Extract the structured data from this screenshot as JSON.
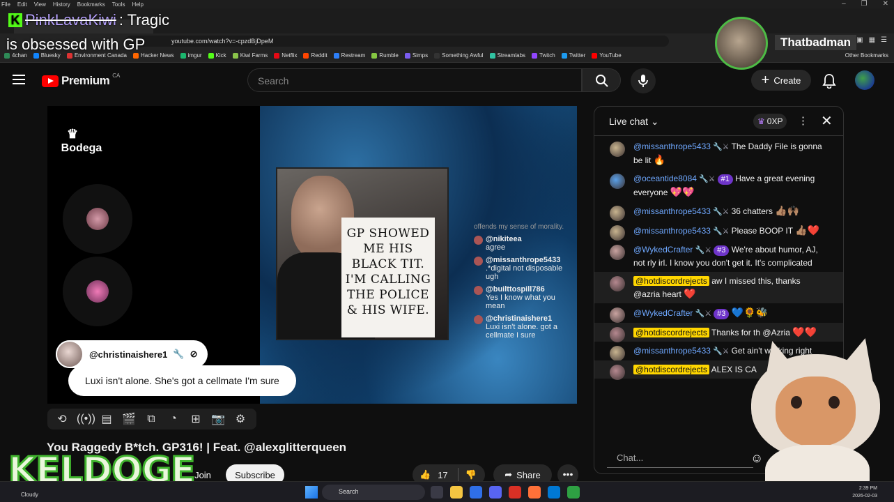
{
  "browser": {
    "menu": [
      "File",
      "Edit",
      "View",
      "History",
      "Bookmarks",
      "Tools",
      "Help"
    ],
    "url": "youtube.com/watch?v=-cpzdBjDpeM",
    "bookmarks": [
      "4chan",
      "Bluesky",
      "Environment Canada",
      "Hacker News",
      "imgur",
      "Kick",
      "Kiwi Farms",
      "Netflix",
      "Reddit",
      "Restream",
      "Rumble",
      "Simps",
      "Something Awful",
      "Streamlabs",
      "Twitch",
      "Twitter",
      "YouTube"
    ],
    "bookmark_colors": [
      "#2e8b57",
      "#1185fe",
      "#d33",
      "#ff6600",
      "#1bb76e",
      "#53fc18",
      "#8ac34a",
      "#e50914",
      "#ff4500",
      "#2d7ff9",
      "#85c742",
      "#7a5cf0",
      "#333333",
      "#31c3a2",
      "#9146ff",
      "#1d9bf0",
      "#ff0000"
    ],
    "other_bookmarks": "Other Bookmarks"
  },
  "overlay": {
    "line1_name": "PinkLavaKiwi",
    "line1_rest": ": Tragic",
    "line2": "is obsessed with GP",
    "streamer_name": "Thatbadman",
    "bottom_logo": "KELDOGE"
  },
  "youtube": {
    "brand": "Premium",
    "region": "CA",
    "search_placeholder": "Search",
    "create_label": "Create"
  },
  "video": {
    "channel_logo": "Bodega",
    "sign_text": "GP SHOWED ME HIS BLACK TIT. I'M CALLING THE POLICE & HIS WIFE.",
    "highlight_user": "@christinaishere1",
    "highlight_message": "Luxi isn't alone. She's got a cellmate I'm sure",
    "embedded_chat": [
      {
        "user": "",
        "text": "offends my sense of morality.",
        "faded": true
      },
      {
        "user": "@nikiteea",
        "text": "agree"
      },
      {
        "user": "@missanthrope5433",
        "text": ".*digital not disposable ugh"
      },
      {
        "user": "@builttospill786",
        "text": "Yes I know what you mean"
      },
      {
        "user": "@christinaishere1",
        "text": "Luxi isn't alone. got a cellmate I sure"
      }
    ],
    "title": "You Raggedy B*tch. GP316! | Feat. @alexglitterqueen",
    "join_label": "Join",
    "subscribe_label": "Subscribe",
    "likes": "17",
    "share_label": "Share"
  },
  "chat": {
    "title": "Live chat",
    "xp": "0XP",
    "input_placeholder": "Chat...",
    "messages": [
      {
        "user": "@missanthrope5433",
        "badge": "",
        "text": "The Daddy File is gonna be lit",
        "emoji": "🔥",
        "owner": false,
        "color": "#c8b48f"
      },
      {
        "user": "@oceantide8084",
        "badge": "#1",
        "text": "Have a great evening everyone",
        "emoji": "💖💖",
        "owner": false,
        "color": "#5aa0e8"
      },
      {
        "user": "@missanthrope5433",
        "badge": "",
        "text": "36 chatters",
        "emoji": "👍🏽🙌🏽",
        "owner": false,
        "color": "#c8b48f"
      },
      {
        "user": "@missanthrope5433",
        "badge": "",
        "text": "Please BOOP IT",
        "emoji": "👍🏽❤️",
        "owner": false,
        "color": "#c8b48f"
      },
      {
        "user": "@WykedCrafter",
        "badge": "#3",
        "text": "We're about humor, AJ, not rly irl. I know you don't get it. It's complicated",
        "emoji": "",
        "owner": false,
        "color": "#c9a3a0"
      },
      {
        "user": "@hotdiscordrejects",
        "badge": "",
        "text": "aw I missed this, thanks @azria heart",
        "emoji": "❤️",
        "owner": true,
        "color": "#b5888f"
      },
      {
        "user": "@WykedCrafter",
        "badge": "#3",
        "text": "",
        "emoji": "💙🌻🐝",
        "owner": false,
        "color": "#c9a3a0"
      },
      {
        "user": "@hotdiscordrejects",
        "badge": "",
        "text": "Thanks for th @Azria",
        "emoji": "❤️❤️",
        "owner": true,
        "color": "#b5888f"
      },
      {
        "user": "@missanthrope5433",
        "badge": "",
        "text": "Get ain't working right",
        "emoji": "",
        "owner": false,
        "color": "#c8b48f"
      },
      {
        "user": "@hotdiscordrejects",
        "badge": "",
        "text": "ALEX IS CA",
        "emoji": "",
        "owner": true,
        "color": "#b5888f"
      }
    ]
  },
  "taskbar": {
    "weather": "Cloudy",
    "search_label": "Search",
    "time": "2:39 PM",
    "date": "2026-02-03",
    "app_colors": [
      "#3a3a46",
      "#f4c542",
      "#2f6fe8",
      "#5865f2",
      "#d93025",
      "#ff7139",
      "#0078d4",
      "#2ea043"
    ]
  }
}
